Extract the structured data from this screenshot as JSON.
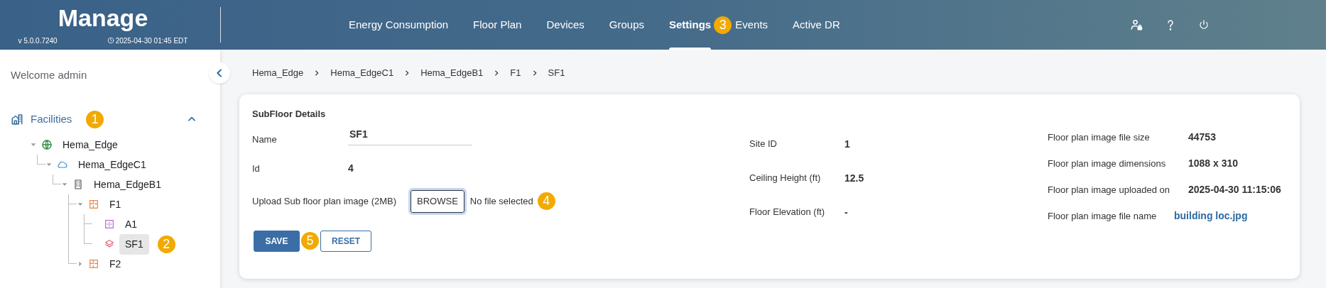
{
  "header": {
    "title": "Manage",
    "version": "v 5.0.0.7240",
    "datetime": "2025-04-30 01:45 EDT"
  },
  "nav": [
    {
      "label": "Energy Consumption",
      "selected": false
    },
    {
      "label": "Floor Plan",
      "selected": false
    },
    {
      "label": "Devices",
      "selected": false
    },
    {
      "label": "Groups",
      "selected": false
    },
    {
      "label": "Settings",
      "selected": true,
      "callout": "3"
    },
    {
      "label": "Events",
      "selected": false
    },
    {
      "label": "Active DR",
      "selected": false
    }
  ],
  "sidebar": {
    "welcome": "Welcome admin",
    "section": {
      "label": "Facilities",
      "expanded": true,
      "callout": "1"
    },
    "tree": [
      {
        "label": "Hema_Edge",
        "kind": "site",
        "expanded": true,
        "selected": false,
        "children": [
          {
            "label": "Hema_EdgeC1",
            "kind": "cloud",
            "expanded": true,
            "selected": false,
            "children": [
              {
                "label": "Hema_EdgeB1",
                "kind": "building",
                "expanded": true,
                "selected": false,
                "children": [
                  {
                    "label": "F1",
                    "kind": "floor",
                    "expanded": true,
                    "selected": false,
                    "children": [
                      {
                        "label": "A1",
                        "kind": "area",
                        "selected": false
                      },
                      {
                        "label": "SF1",
                        "kind": "subfloor",
                        "selected": true,
                        "callout": "2"
                      }
                    ]
                  },
                  {
                    "label": "F2",
                    "kind": "floor",
                    "expanded": false,
                    "selected": false
                  }
                ]
              }
            ]
          }
        ]
      }
    ]
  },
  "breadcrumb": [
    "Hema_Edge",
    "Hema_EdgeC1",
    "Hema_EdgeB1",
    "F1",
    "SF1"
  ],
  "details": {
    "title": "SubFloor Details",
    "column_1": [
      {
        "kind": "input",
        "label": "Name",
        "value": "SF1"
      },
      {
        "kind": "text",
        "label": "Id",
        "value": "4"
      },
      {
        "kind": "upload",
        "label": "Upload Sub floor plan image (2MB)",
        "button": "BROWSE",
        "status": "No file selected",
        "callout": "4"
      }
    ],
    "column_2": [
      {
        "label": "Site ID",
        "value": "1"
      },
      {
        "label": "Ceiling Height (ft)",
        "value": "12.5"
      },
      {
        "label": "Floor Elevation (ft)",
        "value": "-"
      }
    ],
    "column_3": [
      {
        "kind": "text",
        "label": "Floor plan image file size",
        "value": "44753"
      },
      {
        "kind": "text",
        "label": "Floor plan image dimensions",
        "value": "1088 x 310"
      },
      {
        "kind": "text",
        "label": "Floor plan image uploaded on",
        "value": "2025-04-30 11:15:06"
      },
      {
        "kind": "link",
        "label": "Floor plan image file name",
        "value": "building loc.jpg"
      }
    ],
    "buttons": [
      {
        "label": "SAVE",
        "kind": "primary",
        "callout": "5"
      },
      {
        "label": "RESET",
        "kind": "outline"
      }
    ]
  }
}
